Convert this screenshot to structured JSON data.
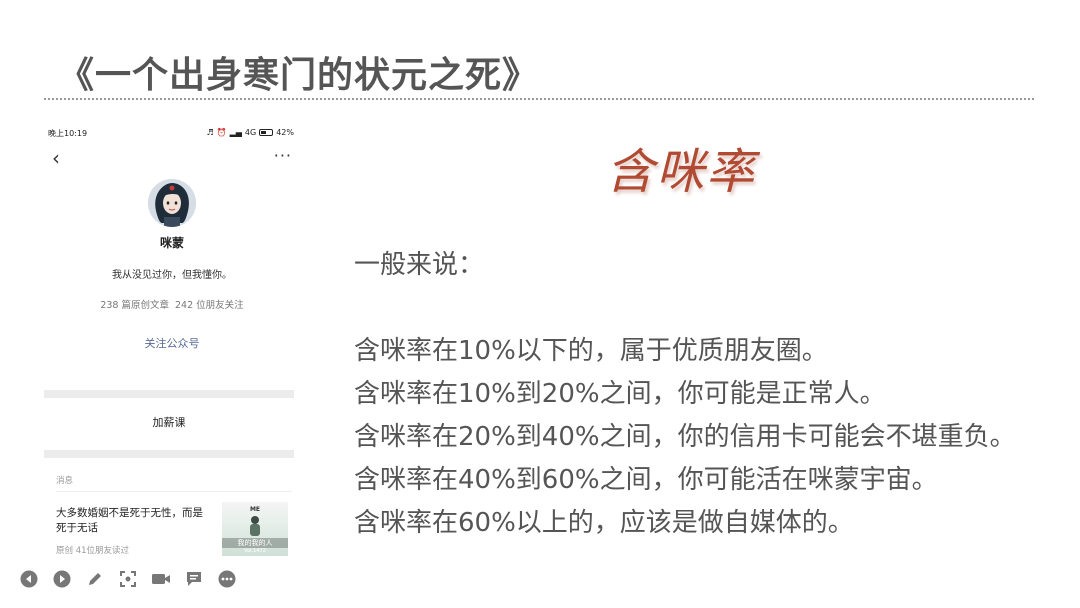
{
  "slide": {
    "title": "《一个出身寒门的状元之死》"
  },
  "phone": {
    "status": {
      "time": "晚上10:19",
      "network": "4G",
      "battery": "42%"
    },
    "profile": {
      "name": "咪蒙",
      "bio": "我从没见过你，但我懂你。",
      "articles": "238 篇原创文章",
      "friends_following": "242 位朋友关注",
      "follow_label": "关注公众号"
    },
    "menu": {
      "item": "加薪课"
    },
    "messages": {
      "label": "消息",
      "article": {
        "title": "大多数婚姻不是死于无性，而是死于无话",
        "meta": "原创 41位朋友读过",
        "thumb_top": "ME",
        "thumb_mid": "我的我的人",
        "thumb_bot": "Vol.1472"
      }
    }
  },
  "content": {
    "brand": "含咪率",
    "intro": "一般来说：",
    "rules": [
      "含咪率在10%以下的，属于优质朋友圈。",
      "含咪率在10%到20%之间，你可能是正常人。",
      "含咪率在20%到40%之间，你的信用卡可能会不堪重负。",
      "含咪率在40%到60%之间，你可能活在咪蒙宇宙。",
      "含咪率在60%以上的，应该是做自媒体的。"
    ]
  },
  "toolbar": {
    "icons": [
      "previous-icon",
      "next-icon",
      "pen-icon",
      "screenshot-icon",
      "camera-icon",
      "comment-icon",
      "more-icon"
    ]
  }
}
